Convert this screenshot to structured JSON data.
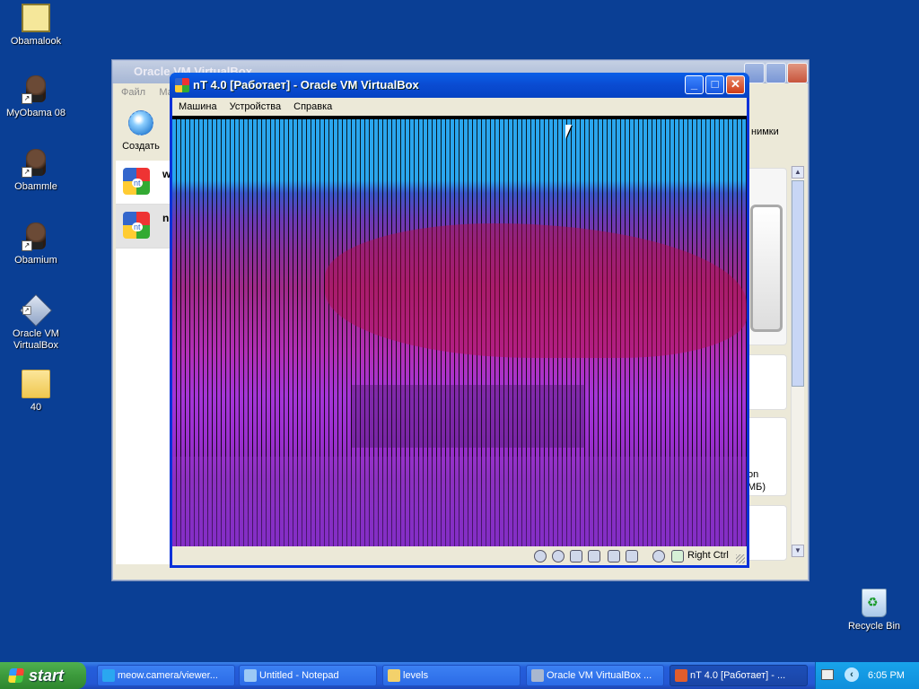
{
  "desktop": {
    "icons": [
      {
        "label": "Obamalook"
      },
      {
        "label": "MyObama 08"
      },
      {
        "label": "Obammle"
      },
      {
        "label": "Obamium"
      },
      {
        "label": "Oracle VM VirtualBox"
      },
      {
        "label": "40"
      }
    ],
    "recycle_bin": "Recycle Bin"
  },
  "manager_window": {
    "title": "Oracle VM VirtualBox",
    "menu": [
      "Файл",
      "Ма"
    ],
    "create_label": "Создать",
    "snapshots_fragment": "нимки",
    "vm_items": [
      {
        "letter": "w",
        "badge": "nt"
      },
      {
        "letter": "n",
        "badge": "nt"
      }
    ],
    "side_fragments": [
      "on",
      "МБ)"
    ]
  },
  "vm_window": {
    "title": "nT 4.0 [Работает] - Oracle VM VirtualBox",
    "menu": [
      "Машина",
      "Устройства",
      "Справка"
    ],
    "host_key": "Right Ctrl"
  },
  "taskbar": {
    "start_label": "start",
    "tasks": [
      {
        "label": "meow.camera/viewer...",
        "icon": "browser-icon",
        "color": "#2aa7f0"
      },
      {
        "label": "Untitled - Notepad",
        "icon": "notepad-icon",
        "color": "#9cc9f5"
      },
      {
        "label": "levels",
        "icon": "folder-icon",
        "color": "#f3d16b"
      },
      {
        "label": "Oracle VM VirtualBox ...",
        "icon": "virtualbox-icon",
        "color": "#a9b7cf"
      },
      {
        "label": "nT 4.0 [Работает] - ...",
        "icon": "nt-icon",
        "color": "#e25d2c"
      }
    ],
    "clock": "6:05 PM"
  }
}
